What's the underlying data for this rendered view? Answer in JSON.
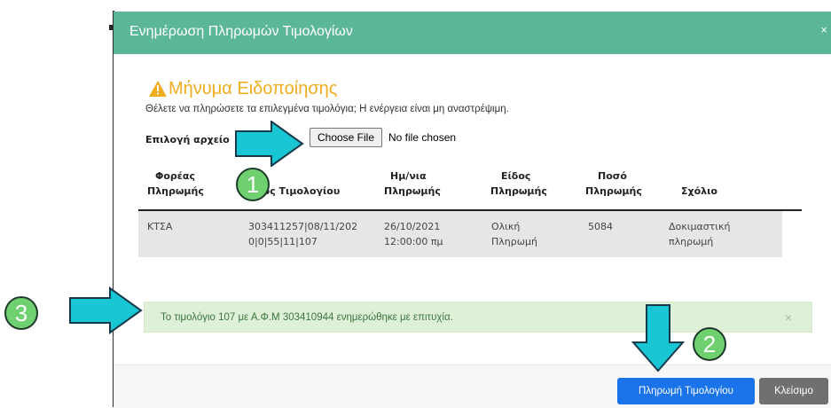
{
  "modal": {
    "title": "Ενημέρωση Πληρωμών Τιμολογίων",
    "close_glyph": "×"
  },
  "warning": {
    "icon": "warning-triangle-icon",
    "title": "Μήνυμα Ειδοποίησης",
    "text": "Θέλετε να πληρώσετε τα επιλεγμένα τιμολόγια; Η ενέργεια είναι μη αναστρέψιμη."
  },
  "file_input": {
    "label": "Επιλογή αρχείο",
    "button": "Choose File",
    "status": "No file chosen"
  },
  "table": {
    "headers": [
      [
        "Φορέας",
        "Πληρωμής"
      ],
      [
        "",
        "θμός Τιμολογίου"
      ],
      [
        "Ημ/νια",
        "Πληρωμής"
      ],
      [
        "Είδος",
        "Πληρωμής"
      ],
      [
        "Ποσό",
        "Πληρωμής"
      ],
      [
        "",
        "Σχόλιο"
      ]
    ],
    "rows": [
      [
        [
          "ΚΤΣΑ"
        ],
        [
          "303411257|08/11/202",
          "0|0|55|11|107"
        ],
        [
          "26/10/2021",
          "12:00:00 πμ"
        ],
        [
          "Ολική",
          "Πληρωμή"
        ],
        [
          "5084"
        ],
        [
          "Δοκιμαστική",
          "πληρωμή"
        ]
      ]
    ]
  },
  "alert": {
    "text": "Το τιμολόγιο 107 με Α.Φ.Μ 303410944 ενημερώθηκε με επιτυχία.",
    "close_glyph": "×"
  },
  "footer": {
    "pay_label": "Πληρωμή Τιμολογίου",
    "close_label": "Κλείσιμο"
  },
  "annotations": [
    "1",
    "2",
    "3"
  ],
  "colors": {
    "header_bg": "#5cb796",
    "warning": "#f0ad1e",
    "alert_bg": "#dff0d8",
    "alert_text": "#3c763d",
    "primary": "#1a73e8",
    "secondary": "#707070",
    "arrow_fill": "#19c6d4",
    "badge_fill": "#6fd06f"
  }
}
